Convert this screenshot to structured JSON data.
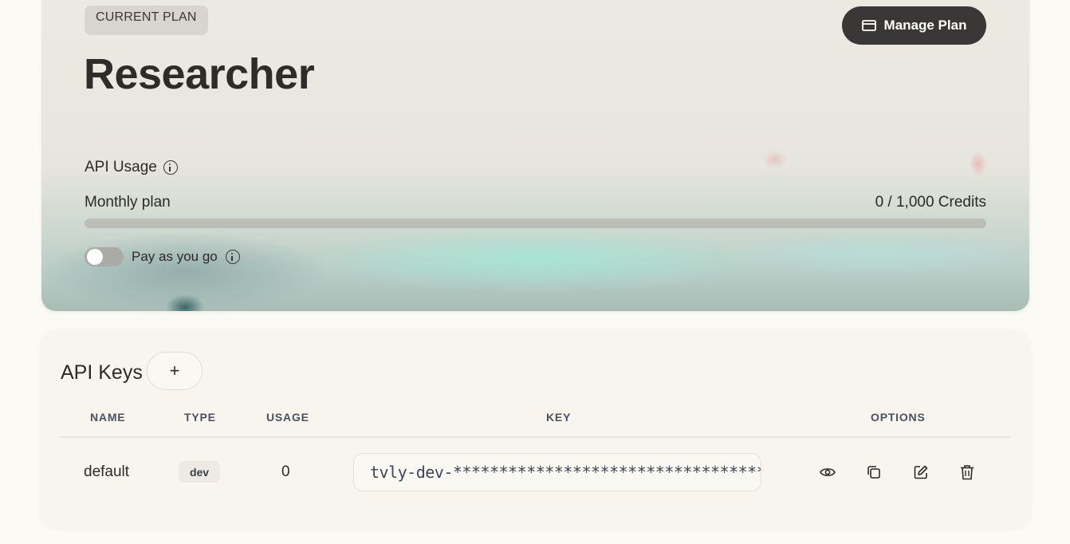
{
  "plan": {
    "badge": "CURRENT PLAN",
    "name": "Researcher",
    "manage_label": "Manage Plan",
    "usage_label": "API Usage",
    "monthly_label": "Monthly plan",
    "credits_text": "0 / 1,000 Credits",
    "usage_fraction": 0,
    "payg_label": "Pay as you go",
    "payg_enabled": false
  },
  "keys": {
    "title": "API Keys",
    "add_label": "+",
    "columns": [
      "NAME",
      "TYPE",
      "USAGE",
      "KEY",
      "OPTIONS"
    ],
    "rows": [
      {
        "name": "default",
        "type": "dev",
        "usage": "0",
        "key": "tvly-dev-********************************************",
        "options": [
          "eye-icon",
          "copy-icon",
          "edit-icon",
          "trash-icon"
        ]
      }
    ]
  },
  "colors": {
    "page_bg": "#fcfaf4",
    "button_dark": "#393836",
    "header_text": "#4b5160"
  }
}
